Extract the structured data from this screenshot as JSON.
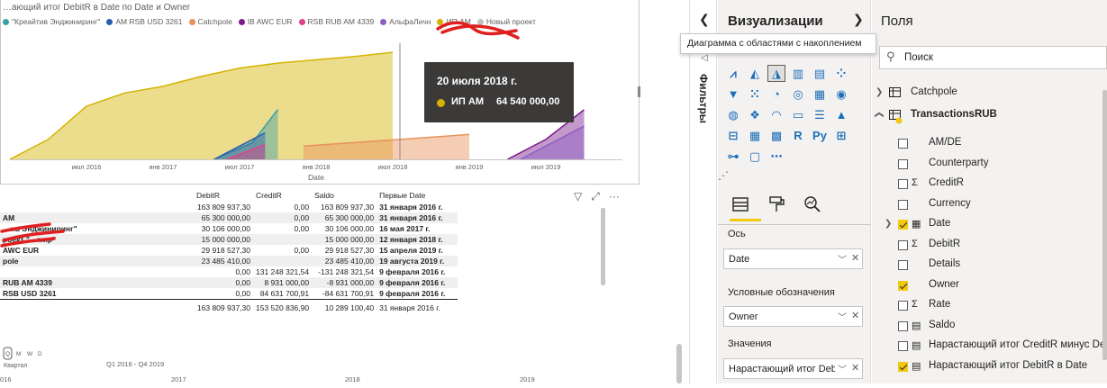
{
  "chart": {
    "title": "…ающий итог DebitR в Date по Date и Owner",
    "legend": [
      {
        "label": "\"Креайтив Энджиниринг\"",
        "color": "#3c9fa8"
      },
      {
        "label": "AM RSB USD 3261",
        "color": "#2a5fb0"
      },
      {
        "label": "Catchpole",
        "color": "#e8915c"
      },
      {
        "label": "IB AWC EUR",
        "color": "#7a1a8a"
      },
      {
        "label": "RSB RUB AM 4339",
        "color": "#e0408a"
      },
      {
        "label": "АльфаЛичн",
        "color": "#8d5fc5"
      },
      {
        "label": "ИП АМ",
        "color": "#d4b300"
      },
      {
        "label": "Новый проект",
        "color": "#c0c0c0"
      }
    ],
    "x_ticks": [
      "июл 2016",
      "янв 2017",
      "июл 2017",
      "янв 2018",
      "июл 2018",
      "янв 2019",
      "июл 2019"
    ],
    "x_axis_label": "Date",
    "tooltip": {
      "date": "20 июля 2018 г.",
      "series": "ИП АМ",
      "value": "64 540 000,00",
      "color": "#d4b300"
    }
  },
  "chart_data": {
    "type": "area",
    "title": "…ающий итог DebitR в Date по Date и Owner",
    "xlabel": "Date",
    "ylabel": "",
    "stacked": true,
    "x_ticks": [
      "июл 2016",
      "янв 2017",
      "июл 2017",
      "янв 2018",
      "июл 2018",
      "янв 2019",
      "июл 2019"
    ],
    "series": [
      {
        "name": "ИП АМ",
        "color": "#d4b300",
        "points": [
          [
            "2016-01",
            0
          ],
          [
            "2016-04",
            12
          ],
          [
            "2016-07",
            32
          ],
          [
            "2016-10",
            40
          ],
          [
            "2017-01",
            44
          ],
          [
            "2017-04",
            50
          ],
          [
            "2017-07",
            55
          ],
          [
            "2017-10",
            58
          ],
          [
            "2018-01",
            60
          ],
          [
            "2018-04",
            62
          ],
          [
            "2018-07",
            64.54
          ]
        ]
      },
      {
        "name": "\"Креайтив Энджиниринг\"",
        "color": "#3c9fa8",
        "points": [
          [
            "2017-05",
            0
          ],
          [
            "2017-08",
            10
          ],
          [
            "2017-10",
            30.1
          ]
        ]
      },
      {
        "name": "AM RSB USD 3261",
        "color": "#2a5fb0",
        "points": [
          [
            "2017-05",
            0
          ],
          [
            "2017-07",
            8
          ],
          [
            "2017-09",
            16
          ]
        ]
      },
      {
        "name": "RSB RUB AM 4339",
        "color": "#e0408a",
        "points": [
          [
            "2017-06",
            0
          ],
          [
            "2017-09",
            8.9
          ]
        ]
      },
      {
        "name": "Catchpole",
        "color": "#e8915c",
        "points": [
          [
            "2017-12",
            8
          ],
          [
            "2019-01",
            15
          ]
        ]
      },
      {
        "name": "IB AWC EUR",
        "color": "#7a1a8a",
        "points": [
          [
            "2019-04",
            0
          ],
          [
            "2019-07",
            12
          ],
          [
            "2019-10",
            29.9
          ]
        ]
      },
      {
        "name": "АльфаЛичн",
        "color": "#8d5fc5",
        "points": [
          [
            "2019-05",
            0
          ],
          [
            "2019-10",
            20
          ]
        ]
      }
    ]
  },
  "table": {
    "headers": [
      "",
      "DebitR",
      "CreditR",
      "Saldo",
      "Первые Date"
    ],
    "rows": [
      {
        "owner": "",
        "debit": "163 809 937,30",
        "credit": "0,00",
        "saldo": "163 809 937,30",
        "date": "31 января 2016 г."
      },
      {
        "owner": "AM",
        "debit": "65 300 000,00",
        "credit": "0,00",
        "saldo": "65 300 000,00",
        "date": "31 января 2016 г."
      },
      {
        "owner": "…ив Энджиниринг\"",
        "debit": "30 106 000,00",
        "credit": "0,00",
        "saldo": "30 106 000,00",
        "date": "16 мая 2017 г."
      },
      {
        "owner": "роект \"…мир\"",
        "debit": "15 000 000,00",
        "credit": "",
        "saldo": "15 000 000,00",
        "date": "12 января 2018 г."
      },
      {
        "owner": "AWC EUR",
        "debit": "29 918 527,30",
        "credit": "0,00",
        "saldo": "29 918 527,30",
        "date": "15 апреля 2019 г."
      },
      {
        "owner": "pole",
        "debit": "23 485 410,00",
        "credit": "",
        "saldo": "23 485 410,00",
        "date": "19 августа 2019 г."
      },
      {
        "owner": "",
        "debit": "0,00",
        "credit": "131 248 321,54",
        "saldo": "-131 248 321,54",
        "date": "9 февраля 2016 г."
      },
      {
        "owner": "RUB AM 4339",
        "debit": "0,00",
        "credit": "8 931 000,00",
        "saldo": "-8 931 000,00",
        "date": "9 февраля 2016 г."
      },
      {
        "owner": "RSB USD 3261",
        "debit": "0,00",
        "credit": "84 631 700,91",
        "saldo": "-84 631 700,91",
        "date": "9 февраля 2016 г."
      }
    ],
    "total": {
      "debit": "163 809 937,30",
      "credit": "153 520 836,90",
      "saldo": "10 289 100,40",
      "date": "31 января 2016 г."
    }
  },
  "slicer": {
    "levels": [
      "Q",
      "M",
      "W",
      "D"
    ],
    "level_name": "Квартал",
    "range": "Q1 2016 - Q4 2019",
    "years": [
      "016",
      "2017",
      "2018",
      "2019"
    ]
  },
  "filters": {
    "label": "Фильтры"
  },
  "viz": {
    "title": "Визуализации",
    "tooltip": "Диаграмма с областями с накоплением",
    "axis_label": "Ось",
    "axis_value": "Date",
    "legend_label": "Условные обозначения",
    "legend_value": "Owner",
    "values_label": "Значения",
    "values_value": "Нарастающий итог DebitR в Date"
  },
  "fields": {
    "title": "Поля",
    "search_placeholder": "Поиск",
    "table1": "Catchpole",
    "table2": "TransactionsRUB",
    "items": [
      {
        "label": "AM/DE",
        "checked": false,
        "type": ""
      },
      {
        "label": "Counterparty",
        "checked": false,
        "type": ""
      },
      {
        "label": "CreditR",
        "checked": false,
        "type": "Σ"
      },
      {
        "label": "Currency",
        "checked": false,
        "type": ""
      },
      {
        "label": "Date",
        "checked": true,
        "type": "cal"
      },
      {
        "label": "DebitR",
        "checked": false,
        "type": "Σ"
      },
      {
        "label": "Details",
        "checked": false,
        "type": ""
      },
      {
        "label": "Owner",
        "checked": true,
        "type": ""
      },
      {
        "label": "Rate",
        "checked": false,
        "type": "Σ"
      },
      {
        "label": "Saldo",
        "checked": false,
        "type": "calc"
      },
      {
        "label": "Нарастающий итог CreditR минус Del",
        "checked": false,
        "type": "calc"
      },
      {
        "label": "Нарастающий итог DebitR в Date",
        "checked": true,
        "type": "calc"
      }
    ]
  }
}
